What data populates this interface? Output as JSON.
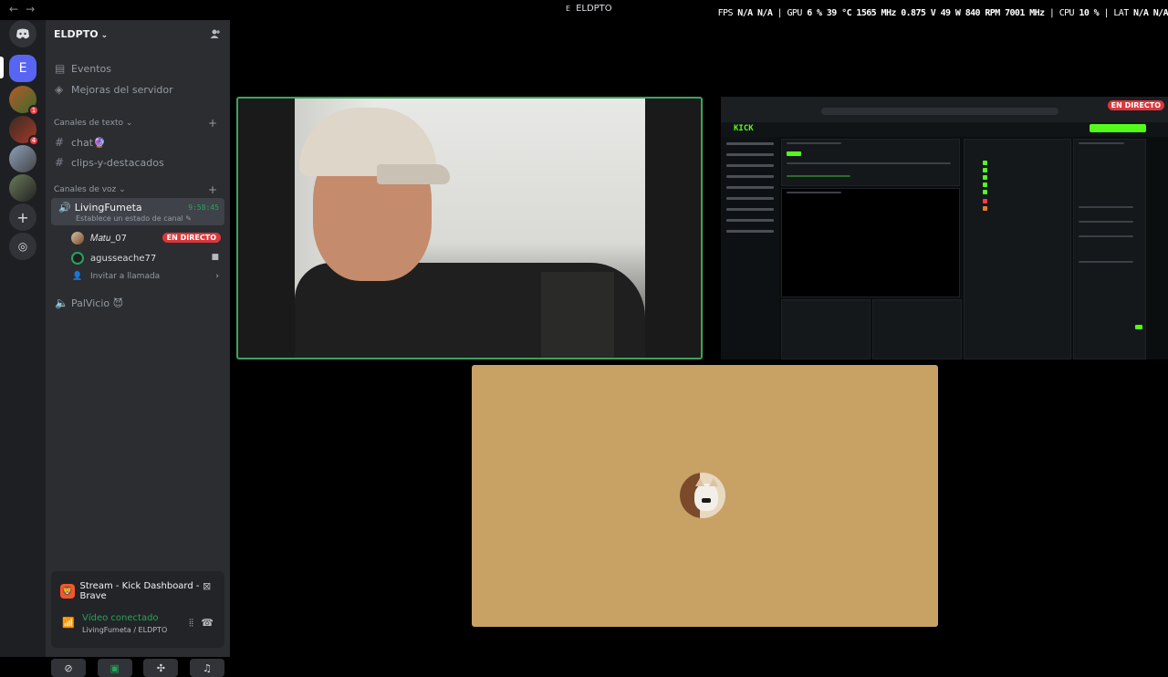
{
  "titlebar": {
    "server_letter": "E",
    "title": "ELDPTO"
  },
  "overlay": {
    "fps_label": "FPS",
    "fps_value": "N/A",
    "fps_value2": "N/A",
    "gpu_label": "GPU",
    "gpu_load": "6 %",
    "gpu_temp": "39 °C",
    "gpu_clock": "1565 MHz",
    "gpu_volt": "0.875 V",
    "gpu_power": "49 W",
    "gpu_fan": "840 RPM",
    "gpu_mem": "7001 MHz",
    "cpu_label": "CPU",
    "cpu_load": "10 %",
    "lat_label": "LAT",
    "lat_value": "N/A",
    "lat_value2": "N/A"
  },
  "rail": {
    "server_e_letter": "E",
    "badges": [
      "1",
      "4"
    ]
  },
  "server": {
    "name": "ELDPTO",
    "events_label": "Eventos",
    "boosts_label": "Mejoras del servidor",
    "text_category": "Canales de texto",
    "text_channels": [
      "chat🔮",
      "clips-y-destacados"
    ],
    "voice_category": "Canales de voz",
    "voice_channel": {
      "name": "LivingFumeta",
      "timer": "9:58:45",
      "status": "Establece un estado de canal"
    },
    "users": [
      {
        "name": "𝑀𝑎𝑡𝑢_07",
        "badge": "EN DIRECTO"
      },
      {
        "name": "agusseache77"
      }
    ],
    "invite_label": "Invitar a llamada",
    "other_voice_channel": "PalVicio 😈"
  },
  "panel": {
    "stream_title": "Stream - Kick Dashboard - Brave",
    "connection_status": "Vídeo conectado",
    "connection_sub": "LivingFumeta / ELDPTO"
  },
  "stage": {
    "screen_live_tag": "EN DIRECTO",
    "kick_logo": "KICK"
  },
  "colors": {
    "accent_green": "#23a55a",
    "live_red": "#da373c",
    "kick_green": "#53fc18",
    "sidebar_bg": "#2b2d31",
    "avatar_tile": "#c8a165"
  }
}
